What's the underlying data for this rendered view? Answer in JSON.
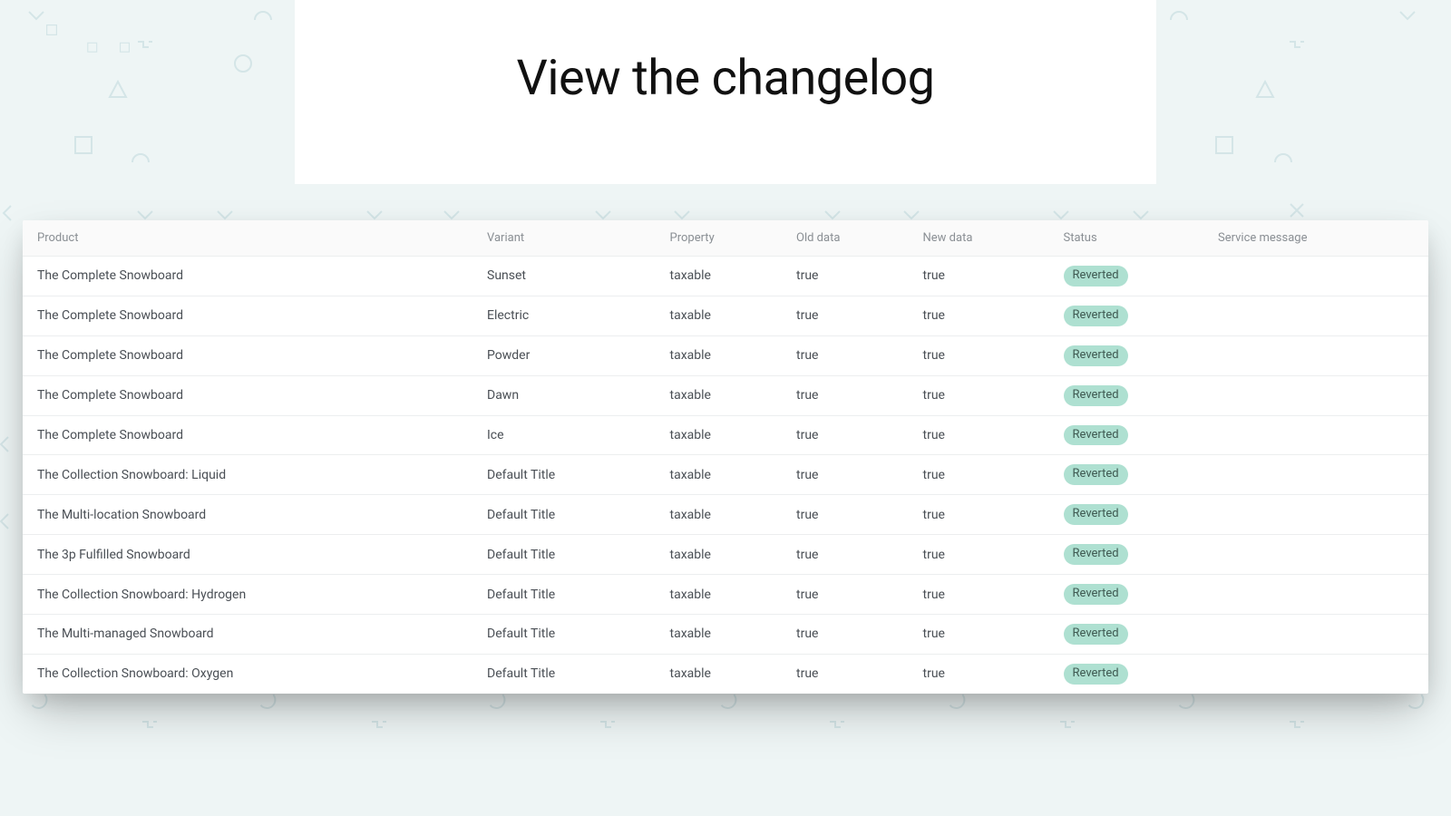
{
  "hero": {
    "title": "View the changelog"
  },
  "table": {
    "headers": {
      "product": "Product",
      "variant": "Variant",
      "property": "Property",
      "old_data": "Old data",
      "new_data": "New data",
      "status": "Status",
      "service_message": "Service message"
    },
    "rows": [
      {
        "product": "The Complete Snowboard",
        "variant": "Sunset",
        "property": "taxable",
        "old_data": "true",
        "new_data": "true",
        "status": "Reverted",
        "service_message": ""
      },
      {
        "product": "The Complete Snowboard",
        "variant": "Electric",
        "property": "taxable",
        "old_data": "true",
        "new_data": "true",
        "status": "Reverted",
        "service_message": ""
      },
      {
        "product": "The Complete Snowboard",
        "variant": "Powder",
        "property": "taxable",
        "old_data": "true",
        "new_data": "true",
        "status": "Reverted",
        "service_message": ""
      },
      {
        "product": "The Complete Snowboard",
        "variant": "Dawn",
        "property": "taxable",
        "old_data": "true",
        "new_data": "true",
        "status": "Reverted",
        "service_message": ""
      },
      {
        "product": "The Complete Snowboard",
        "variant": "Ice",
        "property": "taxable",
        "old_data": "true",
        "new_data": "true",
        "status": "Reverted",
        "service_message": ""
      },
      {
        "product": "The Collection Snowboard: Liquid",
        "variant": "Default Title",
        "property": "taxable",
        "old_data": "true",
        "new_data": "true",
        "status": "Reverted",
        "service_message": ""
      },
      {
        "product": "The Multi-location Snowboard",
        "variant": "Default Title",
        "property": "taxable",
        "old_data": "true",
        "new_data": "true",
        "status": "Reverted",
        "service_message": ""
      },
      {
        "product": "The 3p Fulfilled Snowboard",
        "variant": "Default Title",
        "property": "taxable",
        "old_data": "true",
        "new_data": "true",
        "status": "Reverted",
        "service_message": ""
      },
      {
        "product": "The Collection Snowboard: Hydrogen",
        "variant": "Default Title",
        "property": "taxable",
        "old_data": "true",
        "new_data": "true",
        "status": "Reverted",
        "service_message": ""
      },
      {
        "product": "The Multi-managed Snowboard",
        "variant": "Default Title",
        "property": "taxable",
        "old_data": "true",
        "new_data": "true",
        "status": "Reverted",
        "service_message": ""
      },
      {
        "product": "The Collection Snowboard: Oxygen",
        "variant": "Default Title",
        "property": "taxable",
        "old_data": "true",
        "new_data": "true",
        "status": "Reverted",
        "service_message": ""
      }
    ]
  },
  "colors": {
    "badge_bg": "#aee0d1",
    "bg": "#eef5f5",
    "shape": "#a6c9d0"
  }
}
